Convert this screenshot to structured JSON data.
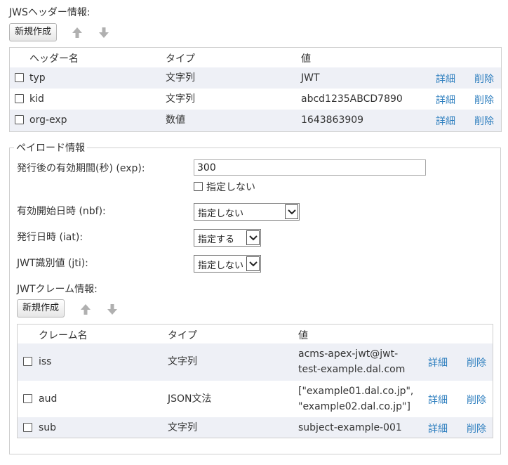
{
  "jws_header": {
    "title": "JWSヘッダー情報:",
    "new_button": "新規作成",
    "columns": {
      "name": "ヘッダー名",
      "type": "タイプ",
      "value": "値"
    },
    "rows": [
      {
        "name": "typ",
        "type": "文字列",
        "value": "JWT",
        "detail": "詳細",
        "delete": "削除"
      },
      {
        "name": "kid",
        "type": "文字列",
        "value": "abcd1235ABCD7890",
        "detail": "詳細",
        "delete": "削除"
      },
      {
        "name": "org-exp",
        "type": "数値",
        "value": "1643863909",
        "detail": "詳細",
        "delete": "削除"
      }
    ]
  },
  "payload": {
    "legend": "ペイロード情報",
    "exp": {
      "label": "発行後の有効期間(秒) (exp):",
      "value": "300",
      "unspecified_label": "指定しない"
    },
    "nbf": {
      "label": "有効開始日時 (nbf):",
      "selected": "指定しない"
    },
    "iat": {
      "label": "発行日時 (iat):",
      "selected": "指定する"
    },
    "jti": {
      "label": "JWT識別値 (jti):",
      "selected": "指定しない"
    }
  },
  "jwt_claims": {
    "title": "JWTクレーム情報:",
    "new_button": "新規作成",
    "columns": {
      "name": "クレーム名",
      "type": "タイプ",
      "value": "値"
    },
    "rows": [
      {
        "name": "iss",
        "type": "文字列",
        "value_line1": "acms-apex-jwt@jwt-",
        "value_line2": "test-example.dal.com",
        "detail": "詳細",
        "delete": "削除"
      },
      {
        "name": "aud",
        "type": "JSON文法",
        "value_line1": "[\"example01.dal.co.jp\",",
        "value_line2": "\"example02.dal.co.jp\"]",
        "detail": "詳細",
        "delete": "削除"
      },
      {
        "name": "sub",
        "type": "文字列",
        "value_line1": "subject-example-001",
        "value_line2": "",
        "detail": "詳細",
        "delete": "削除"
      }
    ]
  },
  "colors": {
    "link": "#2f7fbf",
    "row_alt": "#eef0f6",
    "arrow": "#b0b0b0"
  }
}
